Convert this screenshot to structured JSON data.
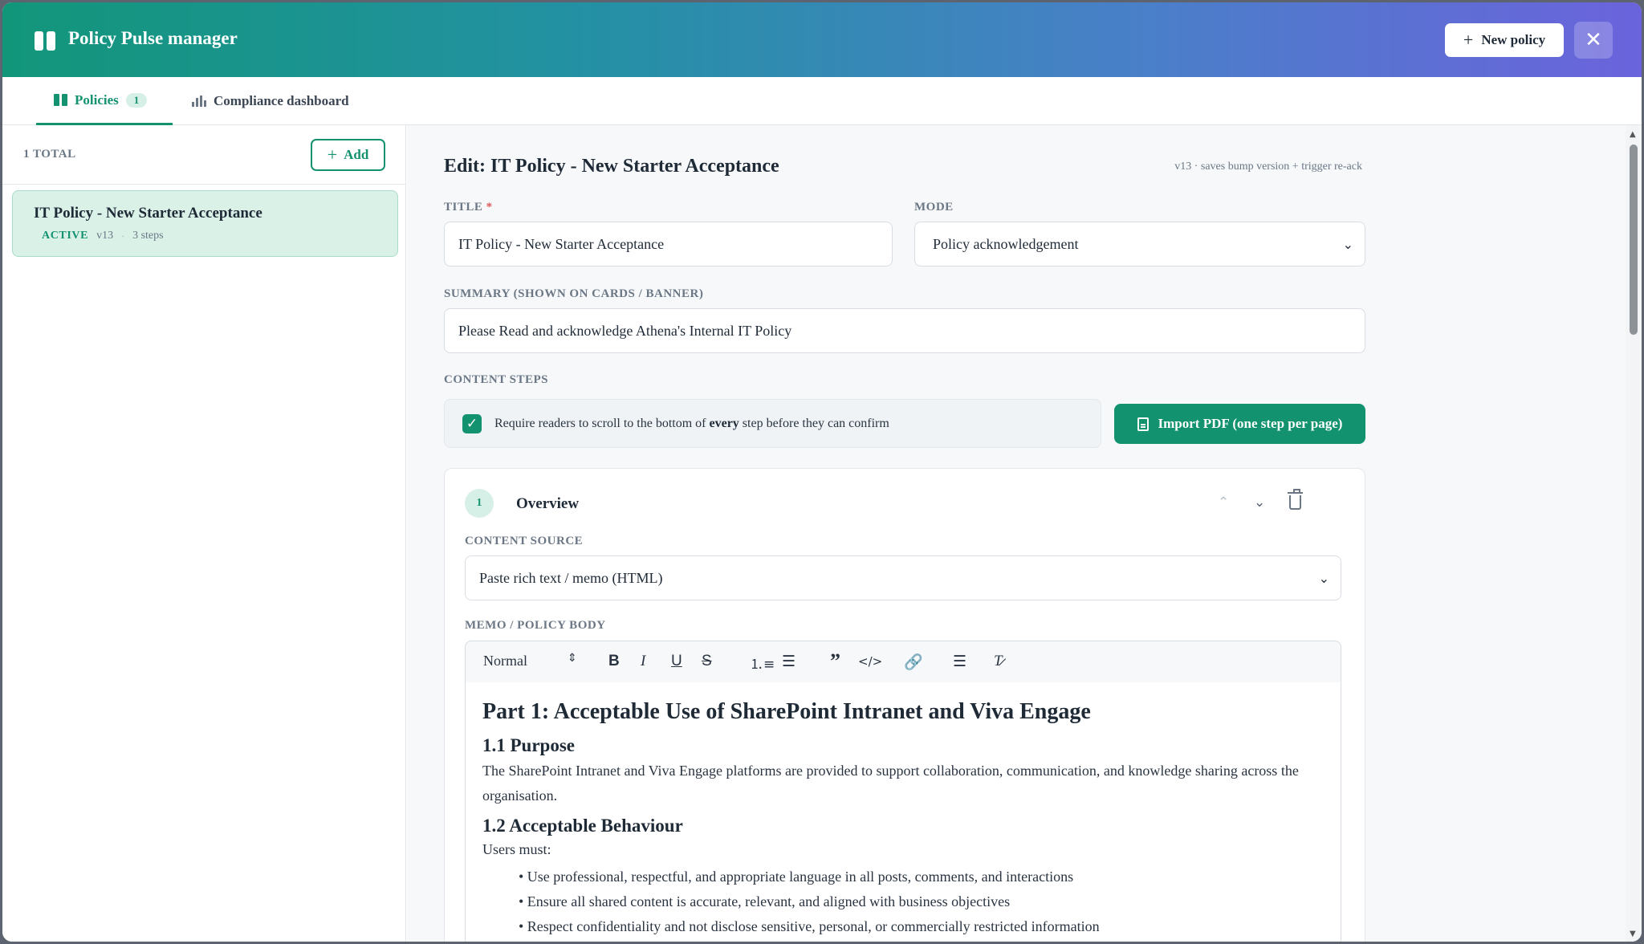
{
  "header": {
    "app_title": "Policy Pulse manager",
    "new_policy_label": "New policy",
    "close_glyph": "✕"
  },
  "tabs": [
    {
      "label": "Policies",
      "badge": "1",
      "active": true
    },
    {
      "label": "Compliance dashboard",
      "active": false
    }
  ],
  "sidebar": {
    "total_label": "1 TOTAL",
    "add_label": "Add",
    "policies": [
      {
        "title": "IT Policy - New Starter Acceptance",
        "status": "ACTIVE",
        "version": "v13",
        "steps": "3 steps"
      }
    ]
  },
  "editor": {
    "heading": "Edit: IT Policy - New Starter Acceptance",
    "version_note": "v13 · saves bump version + trigger re-ack",
    "title_label": "TITLE",
    "title_required": "*",
    "title_value": "IT Policy - New Starter Acceptance",
    "mode_label": "MODE",
    "mode_value": "Policy acknowledgement",
    "summary_label": "SUMMARY (SHOWN ON CARDS / BANNER)",
    "summary_value": "Please Read and acknowledge Athena's Internal IT Policy",
    "content_steps_label": "CONTENT STEPS",
    "scroll_requirement": {
      "checked": true,
      "text_before": "Require readers to scroll to the bottom of ",
      "text_bold": "every",
      "text_after": " step before they can confirm"
    },
    "import_pdf_label": "Import PDF (one step per page)"
  },
  "step": {
    "number": "1",
    "title": "Overview",
    "content_source_label": "CONTENT SOURCE",
    "content_source_value": "Paste rich text / memo (HTML)",
    "memo_label": "MEMO / POLICY BODY",
    "toolbar": {
      "style_value": "Normal",
      "buttons": [
        "bold",
        "italic",
        "underline",
        "strike",
        "ordered-list",
        "bullet-list",
        "blockquote",
        "code",
        "link",
        "align",
        "clear-format"
      ]
    },
    "body": {
      "h1": "Part 1: Acceptable Use of SharePoint Intranet and Viva Engage",
      "h2_purpose": "1.1 Purpose",
      "purpose_text": "The SharePoint Intranet and Viva Engage platforms are provided to support collaboration, communication, and knowledge sharing across the organisation.",
      "h2_behaviour": "1.2 Acceptable Behaviour",
      "users_must": "Users must:",
      "bullets": [
        "• Use professional, respectful, and appropriate language in all posts, comments, and interactions",
        "• Ensure all shared content is accurate, relevant, and aligned with business objectives",
        "• Respect confidentiality and not disclose sensitive, personal, or commercially restricted information"
      ]
    }
  },
  "colors": {
    "accent": "#12926f",
    "header_gradient_start": "#12967a",
    "header_gradient_end": "#6b63dc"
  }
}
